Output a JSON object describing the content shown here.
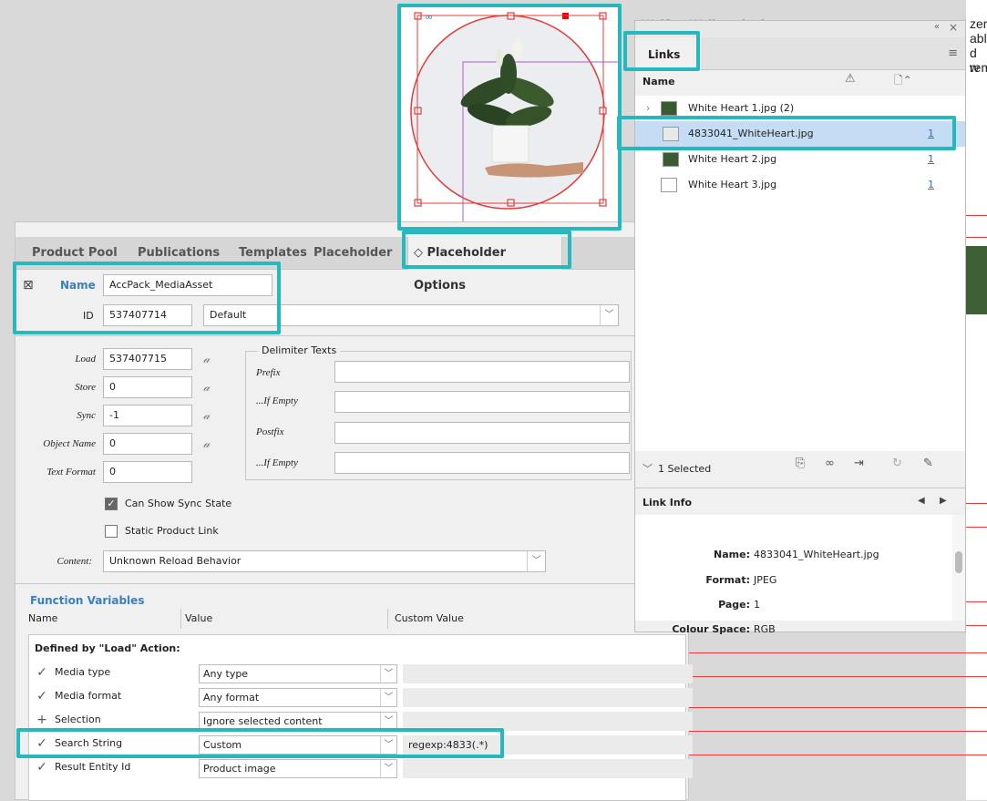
{
  "document": {
    "heading": "Weißes Weihnachtsherz",
    "text_fragments": [
      "zer",
      "abl",
      "d w",
      "rem"
    ]
  },
  "main_panel": {
    "tabs": [
      "Product Pool",
      "Publications",
      "Templates",
      "Placeholder",
      "Placeholder Options"
    ],
    "active_tab_icon": "◇",
    "name_label": "Name",
    "name_value": "AccPack_MediaAsset",
    "id_label": "ID",
    "id_value": "537407714",
    "id_dropdown": "Default",
    "fields": {
      "load_label": "Load",
      "load_value": "537407715",
      "store_label": "Store",
      "store_value": "0",
      "sync_label": "Sync",
      "sync_value": "-1",
      "object_name_label": "Object Name",
      "object_name_value": "0",
      "text_format_label": "Text Format",
      "text_format_value": "0"
    },
    "delimiter": {
      "title": "Delimiter Texts",
      "prefix_label": "Prefix",
      "if_empty_label": "...If Empty",
      "postfix_label": "Postfix",
      "if_empty2_label": "...If Empty"
    },
    "can_show_sync_state": "Can Show Sync State",
    "static_product_link": "Static Product Link",
    "content_label": "Content:",
    "content_value": "Unknown Reload Behavior",
    "function_variables": {
      "title": "Function Variables",
      "col_name": "Name",
      "col_value": "Value",
      "col_custom": "Custom Value",
      "group": "Defined by \"Load\" Action:",
      "rows": [
        {
          "mark": "✓",
          "name": "Media type",
          "value": "Any type",
          "custom": ""
        },
        {
          "mark": "✓",
          "name": "Media format",
          "value": "Any format",
          "custom": ""
        },
        {
          "mark": "+",
          "name": "Selection",
          "value": "Ignore selected content",
          "custom": ""
        },
        {
          "mark": "✓",
          "name": "Search String",
          "value": "Custom",
          "custom": "regexp:4833(.*)"
        },
        {
          "mark": "✓",
          "name": "Result Entity Id",
          "value": "Product image",
          "custom": ""
        }
      ]
    }
  },
  "links_panel": {
    "title": "Links",
    "col_name": "Name",
    "items": [
      {
        "name": "White Heart 1.jpg (2)",
        "count": ""
      },
      {
        "name": "4833041_WhiteHeart.jpg",
        "count": "1"
      },
      {
        "name": "White Heart 2.jpg",
        "count": "1"
      },
      {
        "name": "White Heart 3.jpg",
        "count": "1"
      }
    ],
    "selected_count": "1 Selected",
    "link_info_title": "Link Info",
    "info": {
      "name_label": "Name:",
      "name_value": "4833041_WhiteHeart.jpg",
      "format_label": "Format:",
      "format_value": "JPEG",
      "page_label": "Page:",
      "page_value": "1",
      "colour_label": "Colour Space:",
      "colour_value": "RGB"
    }
  },
  "colors": {
    "highlight": "#25b8bd",
    "accent_blue": "#3c7fc0",
    "selection": "#c5dcf5",
    "frame_red": "#e23c3c"
  }
}
